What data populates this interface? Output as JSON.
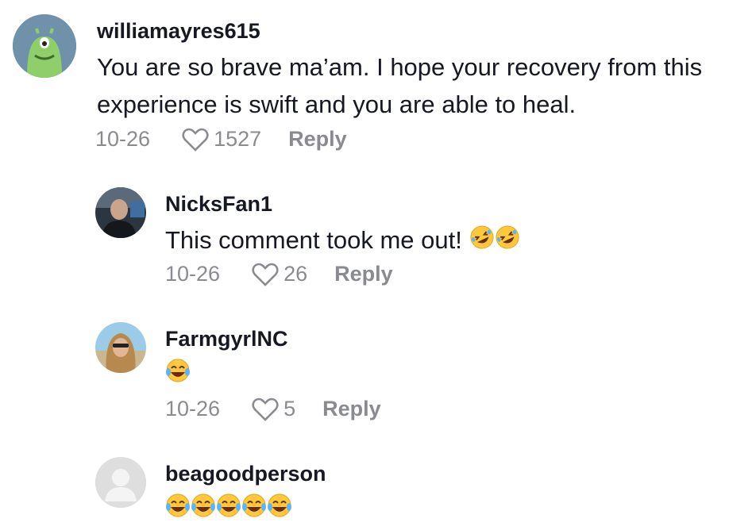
{
  "comments": [
    {
      "username": "williamayres615",
      "text_lines": [
        "You are so brave ma’am. I hope your recovery from this",
        "experience is swift and you are able to heal."
      ],
      "date": "10-26",
      "likes": "1527",
      "reply_label": "Reply"
    },
    {
      "username": "NicksFan1",
      "text": "This comment took me out!",
      "emojis": [
        "rolling-on-floor-laughing",
        "rolling-on-floor-laughing"
      ],
      "date": "10-26",
      "likes": "26",
      "reply_label": "Reply"
    },
    {
      "username": "FarmgyrlNC",
      "emojis": [
        "face-with-tears-of-joy"
      ],
      "date": "10-26",
      "likes": "5",
      "reply_label": "Reply"
    },
    {
      "username": "beagoodperson",
      "emojis": [
        "face-with-tears-of-joy",
        "face-with-tears-of-joy",
        "face-with-tears-of-joy",
        "face-with-tears-of-joy",
        "face-with-tears-of-joy"
      ]
    }
  ],
  "colors": {
    "text": "#161823",
    "meta": "#8a8b91",
    "emoji": "#ffc83d"
  }
}
